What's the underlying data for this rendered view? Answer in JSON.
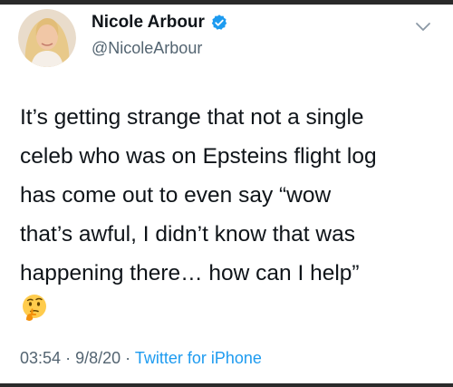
{
  "tweet": {
    "author_name": "Nicole Arbour",
    "handle": "@NicoleArbour",
    "text_lines": [
      "It’s getting strange that not a single",
      "celeb who was on Epsteins flight log",
      "has come out to even say “wow",
      "that’s awful, I didn’t know that was",
      "happening there… how can I help”"
    ],
    "emoji": "thinking-face-icon",
    "time": "03:54",
    "separator": "·",
    "date": "9/8/20",
    "source": "Twitter for iPhone"
  },
  "colors": {
    "text": "#0f1419",
    "secondary": "#536471",
    "accent": "#1d9bf0",
    "verified": "#1d9bf0",
    "frame": "#2a2a2a"
  }
}
